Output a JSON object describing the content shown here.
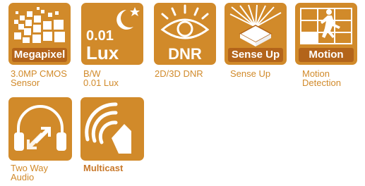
{
  "features": [
    {
      "id": "megapixel",
      "badge": "Megapixel",
      "icon": "megapixel-pixels-icon",
      "caption_lines": [
        "3.0MP CMOS",
        "Sensor"
      ]
    },
    {
      "id": "lux",
      "badge_top": "0.01",
      "badge": "Lux",
      "icon": "moon-star-icon",
      "caption_lines": [
        "B/W",
        "0.01 Lux"
      ]
    },
    {
      "id": "dnr",
      "badge": "DNR",
      "icon": "eye-icon",
      "caption_lines": [
        "2D/3D DNR"
      ]
    },
    {
      "id": "senseup",
      "badge": "Sense Up",
      "icon": "chip-light-icon",
      "caption_lines": [
        "Sense Up"
      ]
    },
    {
      "id": "motion",
      "badge": "Motion",
      "icon": "running-person-grid-icon",
      "caption_lines": [
        "Motion",
        "Detection"
      ]
    },
    {
      "id": "twoway",
      "badge": "",
      "icon": "headphones-icon",
      "caption_lines": [
        "Two Way",
        "Audio"
      ]
    },
    {
      "id": "multicast",
      "badge": "",
      "icon": "speaker-waves-icon",
      "caption_lines": [
        "Multicast"
      ]
    }
  ],
  "colors": {
    "accent": "#d18a2a",
    "accent_dark": "#b3641a",
    "on_accent": "#ffffff"
  }
}
